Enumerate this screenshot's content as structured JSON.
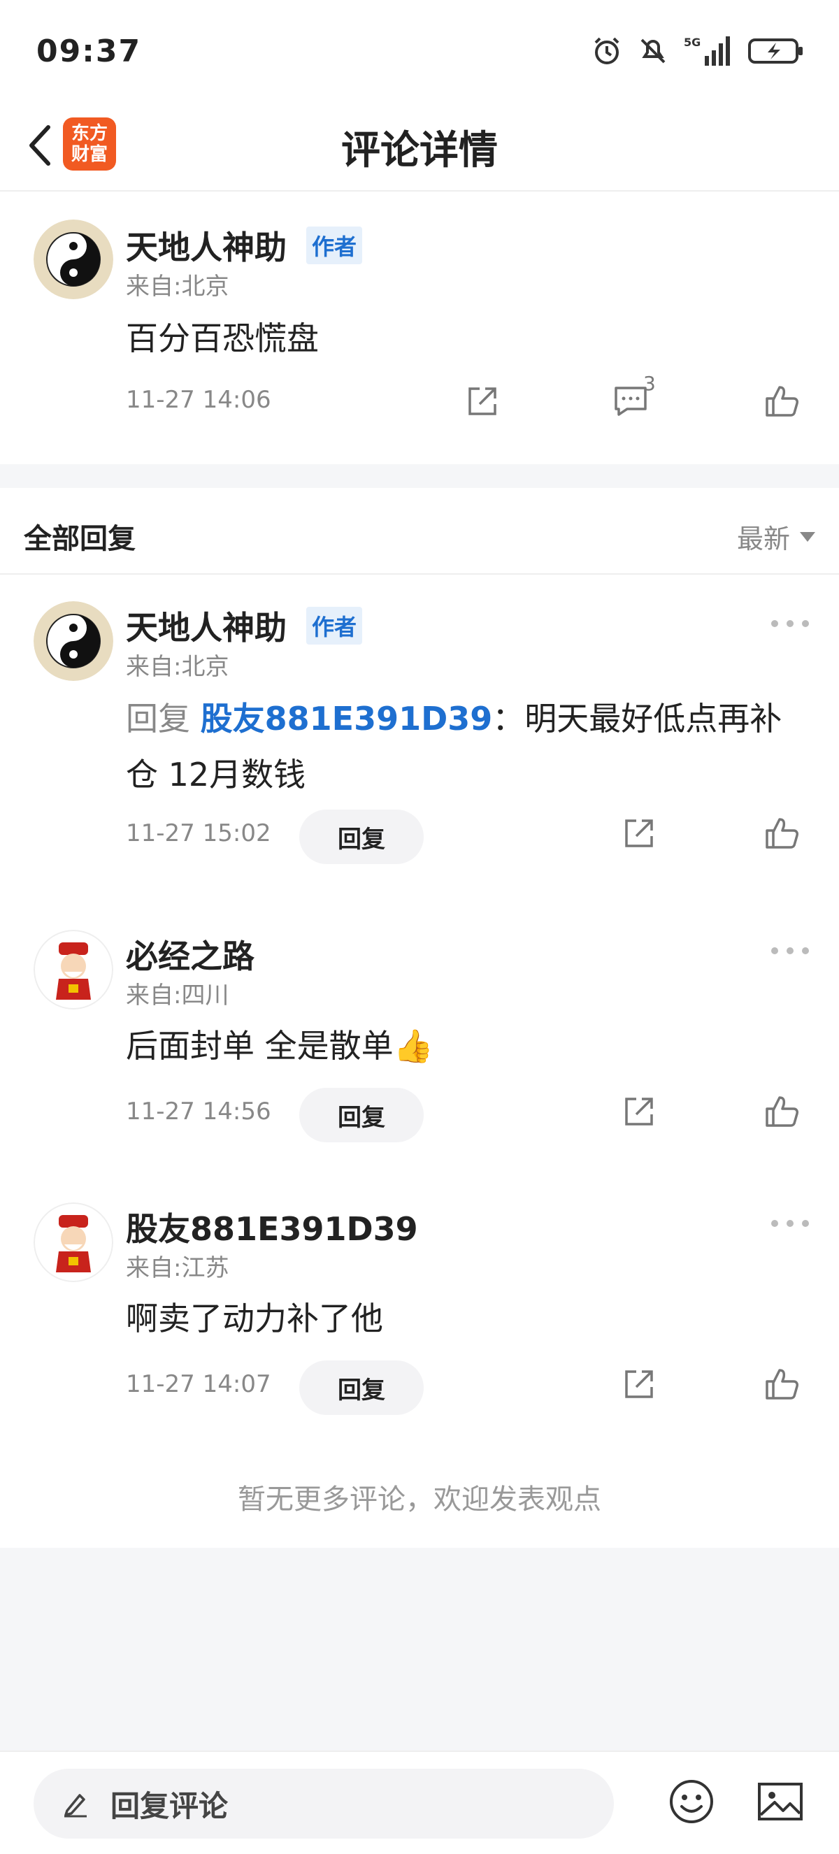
{
  "status_bar": {
    "time": "09:37",
    "icons": [
      "alarm-icon",
      "mute-icon",
      "5g-signal-icon",
      "battery-charging-icon"
    ],
    "network_label": "5G"
  },
  "navbar": {
    "title": "评论详情",
    "app_logo_text_line1": "东方",
    "app_logo_text_line2": "财富",
    "brand_color": "#f15a22"
  },
  "main_comment": {
    "user": "天地人神助",
    "badge": "作者",
    "location": "来自:北京",
    "text": "百分百恐慌盘",
    "time": "11-27 14:06",
    "comment_count": "3"
  },
  "replies_section": {
    "title": "全部回复",
    "sort_label": "最新"
  },
  "replies": [
    {
      "user": "天地人神助",
      "badge": "作者",
      "location": "来自:北京",
      "reply_prefix": "回复",
      "mention": "股友881E391D39",
      "text_line1": "：明天最好低点再补",
      "text_line2": "仓   12月数钱",
      "time": "11-27 15:02",
      "reply_label": "回复"
    },
    {
      "user": "必经之路",
      "location": "来自:四川",
      "text": "后面封单  全是散单",
      "emoji": "👍",
      "time": "11-27 14:56",
      "reply_label": "回复"
    },
    {
      "user": "股友881E391D39",
      "location": "来自:江苏",
      "text": "啊卖了动力补了他",
      "time": "11-27 14:07",
      "reply_label": "回复"
    }
  ],
  "end_message": "暂无更多评论，欢迎发表观点",
  "bottom_bar": {
    "input_placeholder": "回复评论"
  },
  "colors": {
    "accent_blue": "#1e6fd0",
    "muted_gray": "#888888",
    "background_gray": "#f5f6f8"
  }
}
